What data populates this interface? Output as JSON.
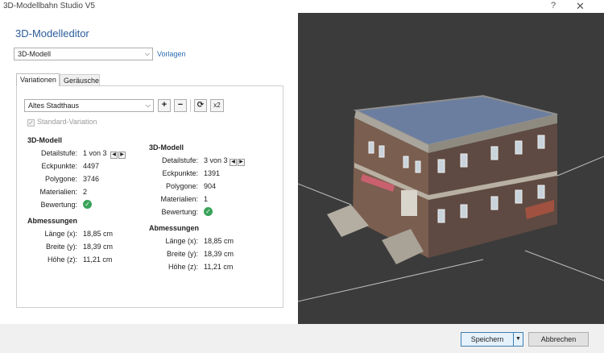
{
  "window": {
    "title": "3D-Modellbahn Studio V5",
    "help": "?",
    "close": "✕"
  },
  "editor": {
    "title": "3D-Modelleditor",
    "model_select": "3D-Modell",
    "vorlagen": "Vorlagen"
  },
  "tabs": [
    {
      "label": "Variationen",
      "active": true
    },
    {
      "label": "Geräusche",
      "active": false
    }
  ],
  "variation": {
    "select": "Altes Stadthaus",
    "add": "+",
    "remove": "−",
    "refresh": "⟳",
    "x2": "x2",
    "standard_label": "Standard-Variation"
  },
  "model_left": {
    "heading": "3D-Modell",
    "rows": [
      {
        "label": "Detailstufe:",
        "value": "1 von 3"
      },
      {
        "label": "Eckpunkte:",
        "value": "4497"
      },
      {
        "label": "Polygone:",
        "value": "3746"
      },
      {
        "label": "Materialien:",
        "value": "2"
      },
      {
        "label": "Bewertung:",
        "value": ""
      }
    ],
    "dims_heading": "Abmessungen",
    "dims": [
      {
        "label": "Länge (x):",
        "value": "18,85 cm"
      },
      {
        "label": "Breite (y):",
        "value": "18,39 cm"
      },
      {
        "label": "Höhe (z):",
        "value": "11,21 cm"
      }
    ]
  },
  "model_right": {
    "heading": "3D-Modell",
    "rows": [
      {
        "label": "Detailstufe:",
        "value": "3 von 3"
      },
      {
        "label": "Eckpunkte:",
        "value": "1391"
      },
      {
        "label": "Polygone:",
        "value": "904"
      },
      {
        "label": "Materialien:",
        "value": "1"
      },
      {
        "label": "Bewertung:",
        "value": ""
      }
    ],
    "dims_heading": "Abmessungen",
    "dims": [
      {
        "label": "Länge (x):",
        "value": "18,85 cm"
      },
      {
        "label": "Breite (y):",
        "value": "18,39 cm"
      },
      {
        "label": "Höhe (z):",
        "value": "11,21 cm"
      }
    ]
  },
  "footer": {
    "save": "Speichern",
    "cancel": "Abbrechen"
  },
  "colors": {
    "accent": "#2b5c9a",
    "ok": "#3aa35a",
    "viewport_bg": "#3b3b3b"
  }
}
